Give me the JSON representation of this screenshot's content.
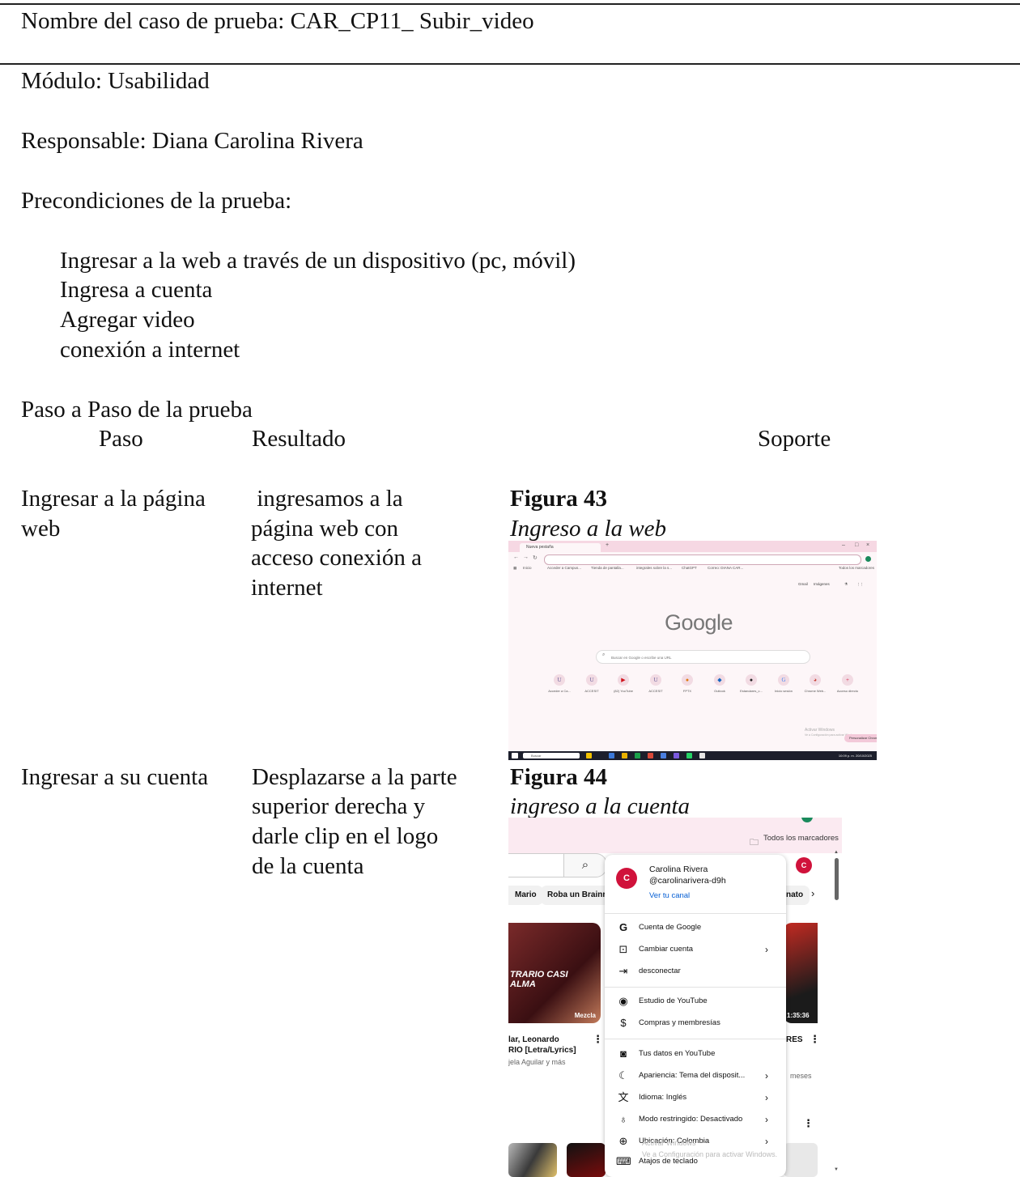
{
  "header": {
    "test_case_name": "Nombre del caso de prueba: CAR_CP11_ Subir_video",
    "module": "Módulo: Usabilidad",
    "owner": "Responsable: Diana Carolina Rivera",
    "preconditions_title": "Precondiciones de la prueba:"
  },
  "preconditions": [
    "Ingresar a la web a través de un dispositivo (pc, móvil)",
    "Ingresa a cuenta",
    "Agregar video",
    "conexión a internet"
  ],
  "steps_section": {
    "title": "Paso a Paso de la prueba",
    "col_step": "Paso",
    "col_result": "Resultado",
    "col_support": "Soporte"
  },
  "steps": [
    {
      "step_lines": [
        "Ingresar a la página",
        "web"
      ],
      "result_lines": [
        " ingresamos a la",
        "página web con",
        "acceso conexión a",
        "internet"
      ],
      "figure_label": "Figura 43",
      "figure_title": "Ingreso a la web"
    },
    {
      "step_lines": [
        "Ingresar a su cuenta"
      ],
      "result_lines": [
        "Desplazarse a la parte",
        "superior derecha y",
        "darle clip en el logo",
        "de la cuenta"
      ],
      "figure_label": "Figura 44",
      "figure_title": "ingreso a la cuenta"
    }
  ],
  "screenshot_google": {
    "tab_label": "Nueva pestaña",
    "bookmarks": [
      "Inicio",
      "Acceder a Campus...",
      "Tienda de pantalla...",
      "integrales sobre la s...",
      "ChatGPT",
      "Correo: DIANA CAR..."
    ],
    "all_bookmarks": "Todos los marcadores",
    "top_links": [
      "Gmail",
      "Imágenes"
    ],
    "logo": "Google",
    "search_placeholder": "Buscar en Google o escribe una URL",
    "shortcuts": [
      {
        "glyph": "U",
        "label": "Acceder a Ca..."
      },
      {
        "glyph": "U",
        "label": "ACCESIT"
      },
      {
        "glyph": "▶",
        "label": "(82) YouTube"
      },
      {
        "glyph": "U",
        "label": "ACCESIT"
      },
      {
        "glyph": "●",
        "label": "FPTX"
      },
      {
        "glyph": "◆",
        "label": "Outlook"
      },
      {
        "glyph": "●",
        "label": "Estandares_c..."
      },
      {
        "glyph": "G",
        "label": "Inicio sesión"
      },
      {
        "glyph": "◕",
        "label": "Chrome Web..."
      },
      {
        "glyph": "+",
        "label": "Acceso directo"
      }
    ],
    "activate_title": "Activar Windows",
    "activate_sub": "Ve a Configuración para activar Windows.",
    "customize": "Personalizar Chrome",
    "taskbar_search": "Buscar",
    "clock": "10:09 p. m.  20/10/2025",
    "accent": "#1a8a5c"
  },
  "screenshot_youtube": {
    "all_bookmarks": "Todos los marcadores",
    "chips": [
      "Mario",
      "Roba un Brainro",
      "nato"
    ],
    "thumb_left_text": "TRARIO CASI ALMA",
    "thumb_left_badge": "Mezcla",
    "thumb_right_duration": "1:35:36",
    "left_video_title": [
      "lar, Leonardo",
      "RIO [Letra/Lyrics]"
    ],
    "left_video_sub": "jela Aguilar y más",
    "right_video_title": "RES",
    "right_video_sub": "meses",
    "account": {
      "initial": "C",
      "name": "Carolina Rivera",
      "handle": "@carolinarivera-d9h",
      "channel_link": "Ver tu canal"
    },
    "menu_groups": [
      [
        {
          "icon": "google-icon",
          "glyph": "G",
          "label": "Cuenta de Google",
          "chevron": false
        },
        {
          "icon": "switch-account-icon",
          "glyph": "⊡",
          "label": "Cambiar cuenta",
          "chevron": true
        },
        {
          "icon": "sign-out-icon",
          "glyph": "⇥",
          "label": "desconectar",
          "chevron": false
        }
      ],
      [
        {
          "icon": "studio-icon",
          "glyph": "◉",
          "label": "Estudio de YouTube",
          "chevron": false
        },
        {
          "icon": "purchases-icon",
          "glyph": "$",
          "label": "Compras y membresías",
          "chevron": false
        }
      ],
      [
        {
          "icon": "your-data-icon",
          "glyph": "◙",
          "label": "Tus datos en YouTube",
          "chevron": false
        },
        {
          "icon": "appearance-icon",
          "glyph": "☾",
          "label": "Apariencia: Tema del disposit...",
          "chevron": true
        },
        {
          "icon": "language-icon",
          "glyph": "文",
          "label": "Idioma: Inglés",
          "chevron": true
        },
        {
          "icon": "restricted-icon",
          "glyph": "♁",
          "label": "Modo restringido: Desactivado",
          "chevron": true
        },
        {
          "icon": "location-icon",
          "glyph": "⊕",
          "label": "Ubicación: Colombia",
          "chevron": true
        },
        {
          "icon": "keyboard-icon",
          "glyph": "⌨",
          "label": "Atajos de teclado",
          "chevron": false
        }
      ]
    ],
    "watermark_title": "Activar Windows",
    "watermark_sub": "Ve a Configuración para activar Windows.",
    "avatar_color": "#d0123b"
  }
}
